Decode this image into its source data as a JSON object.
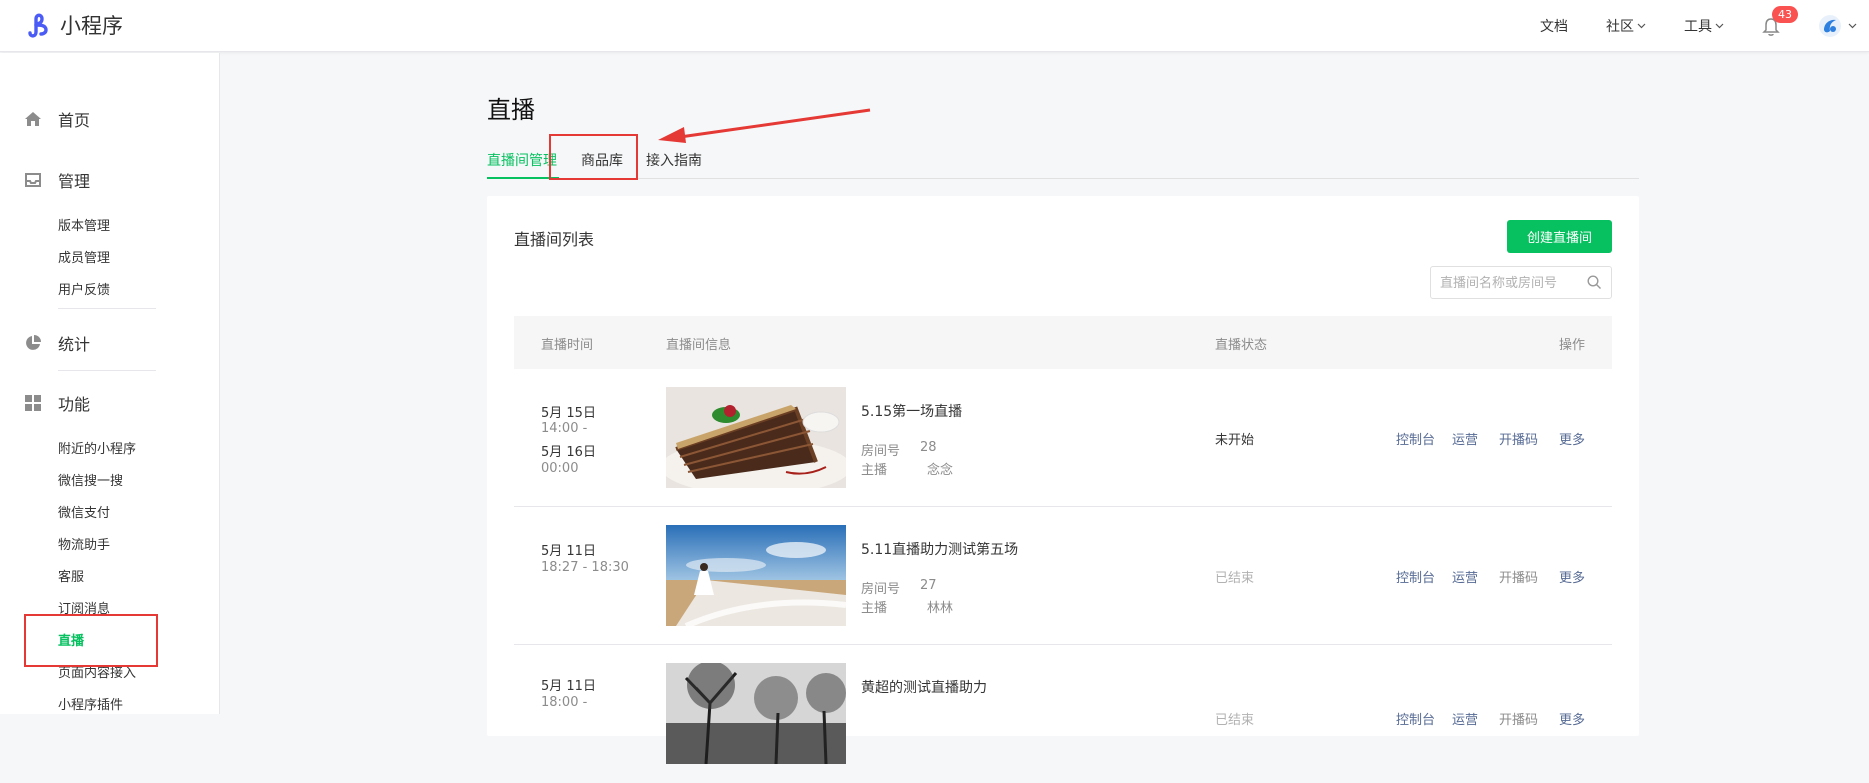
{
  "brand": {
    "name": "小程序",
    "accent": "#4a5cf5"
  },
  "topnav": {
    "docs": "文档",
    "community": "社区",
    "tools": "工具",
    "notifications": "43"
  },
  "sidebar": {
    "groups": [
      {
        "label": "首页",
        "icon": "home-icon"
      },
      {
        "label": "管理",
        "icon": "inbox-icon",
        "items": [
          "版本管理",
          "成员管理",
          "用户反馈"
        ]
      },
      {
        "label": "统计",
        "icon": "pie-chart-icon"
      },
      {
        "label": "功能",
        "icon": "grid-icon",
        "items": [
          "附近的小程序",
          "微信搜一搜",
          "微信支付",
          "物流助手",
          "客服",
          "订阅消息",
          "直播",
          "页面内容接入",
          "小程序插件"
        ]
      }
    ],
    "active_item": "直播"
  },
  "page": {
    "title": "直播",
    "tabs": [
      "直播间管理",
      "商品库",
      "接入指南"
    ],
    "active_tab": "直播间管理"
  },
  "card": {
    "title": "直播间列表",
    "create_button": "创建直播间",
    "search_placeholder": "直播间名称或房间号",
    "columns": [
      "直播时间",
      "直播间信息",
      "直播状态",
      "操作"
    ]
  },
  "rooms": [
    {
      "date_start": "5月 15日",
      "time_start": "14:00 -",
      "date_end": "5月 16日",
      "time_end": "00:00",
      "title": "5.15第一场直播",
      "room_label": "房间号",
      "room_no": "28",
      "host_label": "主播",
      "host": "念念",
      "status": "未开始",
      "actions": [
        "控制台",
        "运营",
        "开播码",
        "更多"
      ]
    },
    {
      "date_start": "5月 11日",
      "time_start": "18:27 - 18:30",
      "title": "5.11直播助力测试第五场",
      "room_label": "房间号",
      "room_no": "27",
      "host_label": "主播",
      "host": "林林",
      "status": "已结束",
      "actions": [
        "控制台",
        "运营",
        "开播码",
        "更多"
      ]
    },
    {
      "date_start": "5月 11日",
      "time_start": "18:00 -",
      "title": "黄超的测试直播助力",
      "status": "已结束",
      "actions": [
        "控制台",
        "运营",
        "开播码",
        "更多"
      ]
    }
  ],
  "colors": {
    "primary": "#07c160",
    "link": "#576b95",
    "annotation": "#e53935",
    "badge": "#fa5151"
  }
}
